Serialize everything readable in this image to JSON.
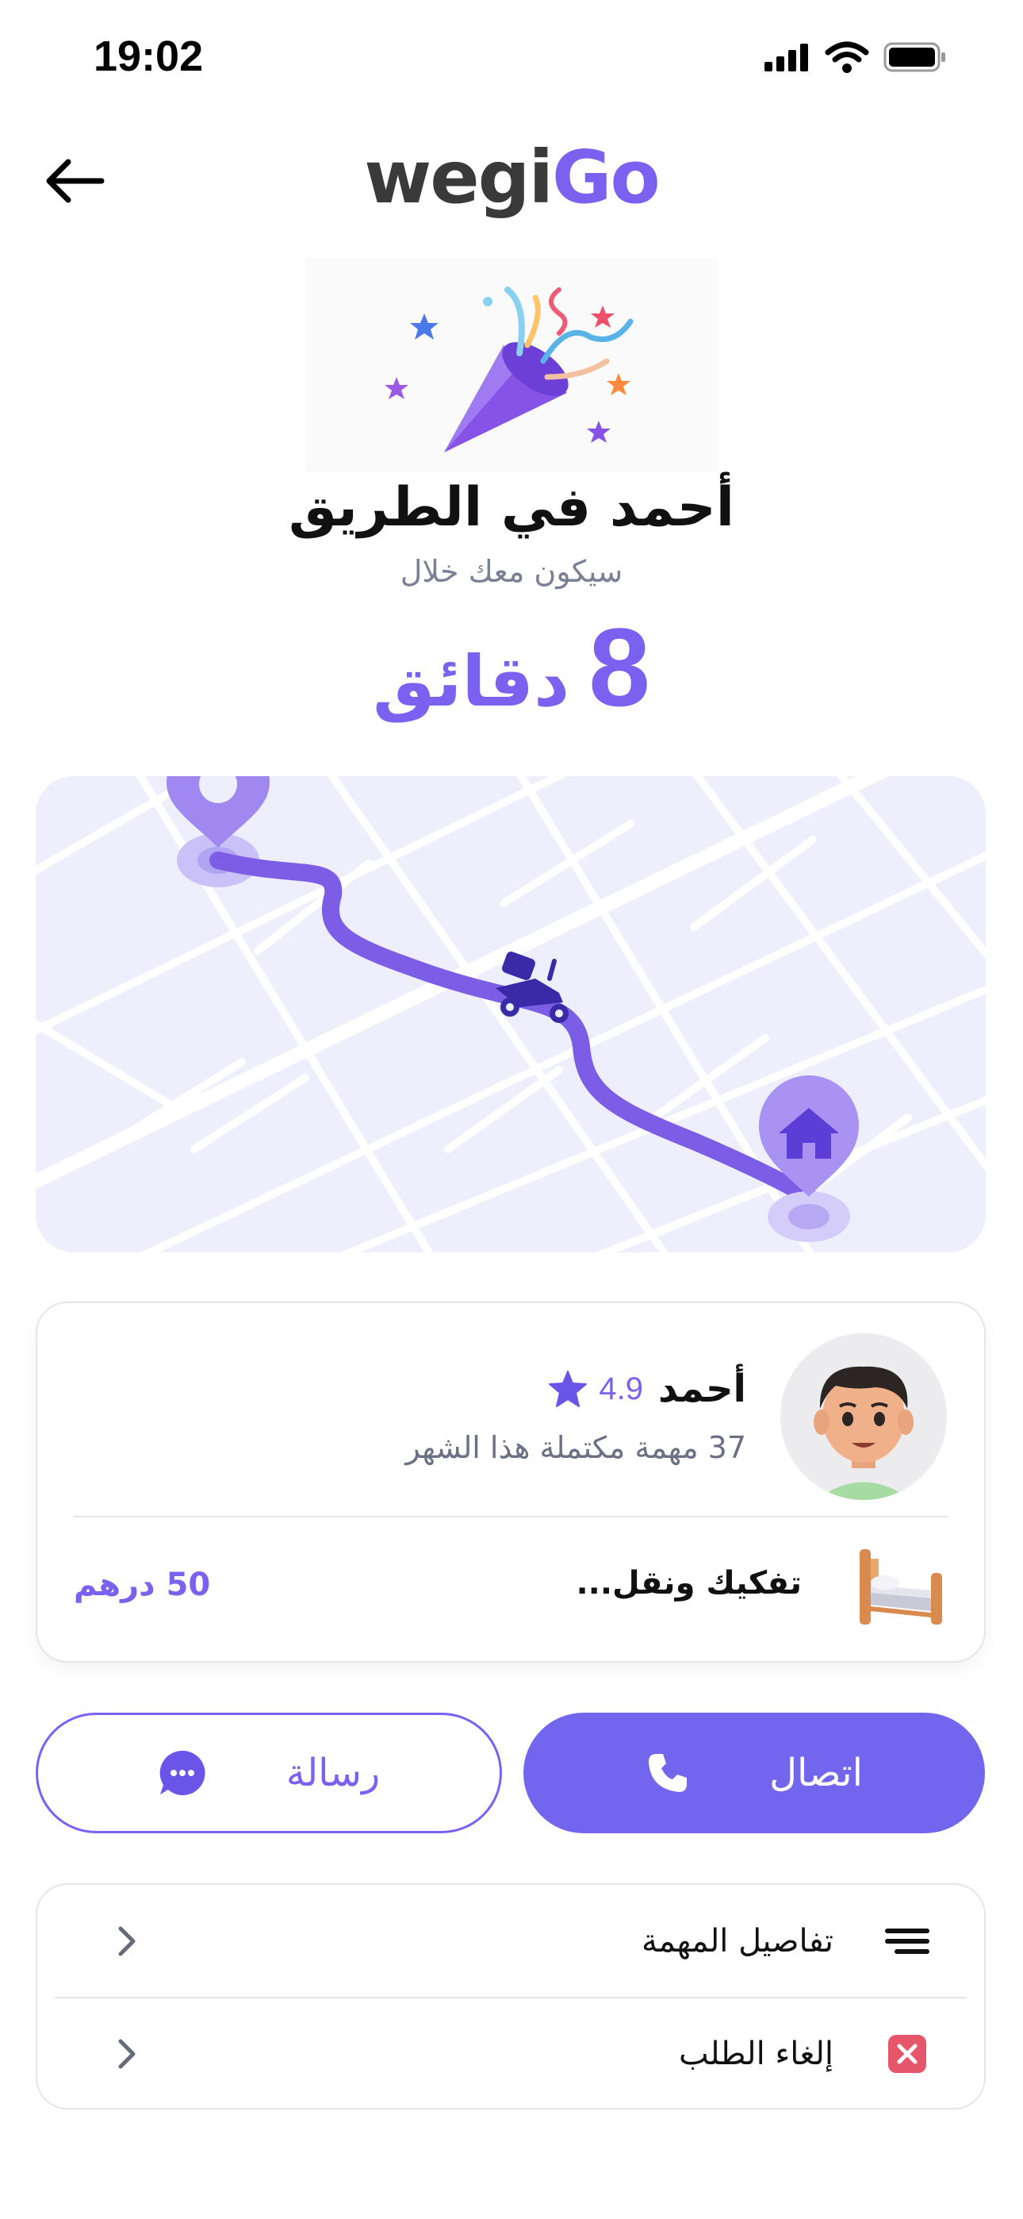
{
  "status_bar": {
    "time": "19:02",
    "icons": [
      "signal-icon",
      "wifi-icon",
      "battery-icon"
    ]
  },
  "header": {
    "logo_part1": "wegi",
    "logo_part2": "Go",
    "back_icon": "arrow-left-icon"
  },
  "hero": {
    "title": "أحمد في الطريق",
    "subtitle": "سيكون معك خلال",
    "eta_number": "8",
    "eta_unit": "دقائق",
    "illustration": "party-popper-icon"
  },
  "courier": {
    "name": "أحمد",
    "rating": "4.9",
    "tasks_completed": "37 مهمة مكتملة هذا الشهر",
    "task_name": "تفكيك ونقل...",
    "task_price": "50 درهم"
  },
  "actions": {
    "call_label": "اتصال",
    "message_label": "رسالة"
  },
  "options": {
    "details_label": "تفاصيل المهمة",
    "cancel_label": "إلغاء الطلب"
  },
  "colors": {
    "accent": "#7b61f0",
    "button": "#7366ee",
    "map_bg": "#eeeefc",
    "cancel": "#e5566b"
  }
}
